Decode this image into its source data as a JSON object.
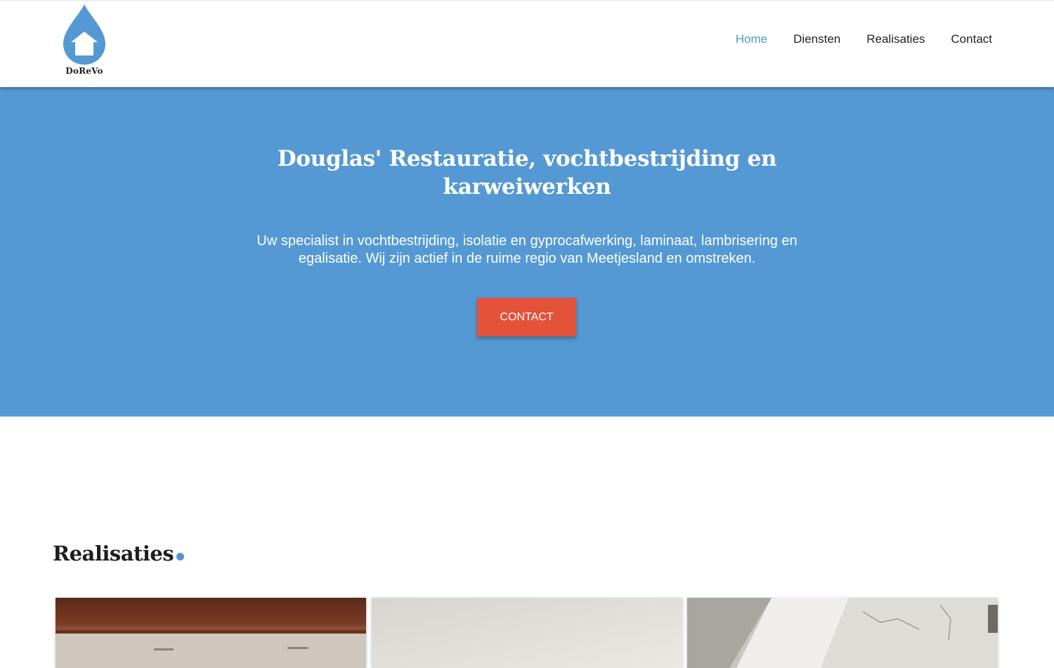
{
  "logo": {
    "text": "DoReVo",
    "icon": "water-drop-house-icon",
    "color": "#5499d4"
  },
  "nav": {
    "items": [
      {
        "label": "Home",
        "active": true
      },
      {
        "label": "Diensten",
        "active": false
      },
      {
        "label": "Realisaties",
        "active": false
      },
      {
        "label": "Contact",
        "active": false
      }
    ],
    "active_color": "#4f97d1"
  },
  "hero": {
    "title": "Douglas' Restauratie, vochtbestrijding en karweiwerken",
    "subtitle": "Uw specialist in vochtbestrijding, isolatie en gyprocafwerking, laminaat, lambrisering en egalisatie. Wij zijn actief in de ruime regio van Meetjesland en omstreken.",
    "cta_label": "CONTACT",
    "background_color": "#5499d4",
    "cta_color": "#e35239"
  },
  "realisaties": {
    "title": "Realisaties",
    "cards": [
      {
        "name": "realisatie-photo-1"
      },
      {
        "name": "realisatie-photo-2"
      },
      {
        "name": "realisatie-photo-3"
      }
    ]
  }
}
